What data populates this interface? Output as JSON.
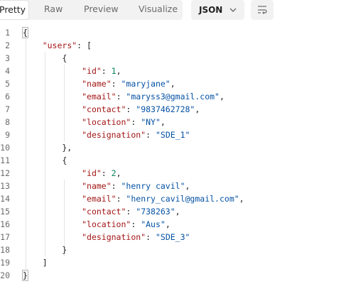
{
  "toolbar": {
    "tabs": [
      {
        "label": "Pretty"
      },
      {
        "label": "Raw"
      },
      {
        "label": "Preview"
      },
      {
        "label": "Visualize"
      }
    ],
    "format_select": {
      "value": "JSON"
    },
    "icons": {
      "chevron": "chevron-down-icon",
      "wrap": "wrap-lines-icon"
    }
  },
  "code": {
    "lines": [
      {
        "n": "1",
        "tokens": [
          {
            "t": "{",
            "c": "p"
          }
        ]
      },
      {
        "n": "2",
        "tokens": [
          {
            "t": "    ",
            "c": "p"
          },
          {
            "t": "\"users\"",
            "c": "k"
          },
          {
            "t": ": [",
            "c": "p"
          }
        ]
      },
      {
        "n": "3",
        "tokens": [
          {
            "t": "        {",
            "c": "p"
          }
        ]
      },
      {
        "n": "4",
        "tokens": [
          {
            "t": "            ",
            "c": "p"
          },
          {
            "t": "\"id\"",
            "c": "k"
          },
          {
            "t": ": ",
            "c": "p"
          },
          {
            "t": "1",
            "c": "n"
          },
          {
            "t": ",",
            "c": "p"
          }
        ]
      },
      {
        "n": "5",
        "tokens": [
          {
            "t": "            ",
            "c": "p"
          },
          {
            "t": "\"name\"",
            "c": "k"
          },
          {
            "t": ": ",
            "c": "p"
          },
          {
            "t": "\"maryjane\"",
            "c": "s"
          },
          {
            "t": ",",
            "c": "p"
          }
        ]
      },
      {
        "n": "6",
        "tokens": [
          {
            "t": "            ",
            "c": "p"
          },
          {
            "t": "\"email\"",
            "c": "k"
          },
          {
            "t": ": ",
            "c": "p"
          },
          {
            "t": "\"maryss3@gmail.com\"",
            "c": "s"
          },
          {
            "t": ",",
            "c": "p"
          }
        ]
      },
      {
        "n": "7",
        "tokens": [
          {
            "t": "            ",
            "c": "p"
          },
          {
            "t": "\"contact\"",
            "c": "k"
          },
          {
            "t": ": ",
            "c": "p"
          },
          {
            "t": "\"9837462728\"",
            "c": "s"
          },
          {
            "t": ",",
            "c": "p"
          }
        ]
      },
      {
        "n": "8",
        "tokens": [
          {
            "t": "            ",
            "c": "p"
          },
          {
            "t": "\"location\"",
            "c": "k"
          },
          {
            "t": ": ",
            "c": "p"
          },
          {
            "t": "\"NY\"",
            "c": "s"
          },
          {
            "t": ",",
            "c": "p"
          }
        ]
      },
      {
        "n": "9",
        "tokens": [
          {
            "t": "            ",
            "c": "p"
          },
          {
            "t": "\"designation\"",
            "c": "k"
          },
          {
            "t": ": ",
            "c": "p"
          },
          {
            "t": "\"SDE_1\"",
            "c": "s"
          }
        ]
      },
      {
        "n": "10",
        "tokens": [
          {
            "t": "        },",
            "c": "p"
          }
        ]
      },
      {
        "n": "11",
        "tokens": [
          {
            "t": "        {",
            "c": "p"
          }
        ]
      },
      {
        "n": "12",
        "tokens": [
          {
            "t": "            ",
            "c": "p"
          },
          {
            "t": "\"id\"",
            "c": "k"
          },
          {
            "t": ": ",
            "c": "p"
          },
          {
            "t": "2",
            "c": "n"
          },
          {
            "t": ",",
            "c": "p"
          }
        ]
      },
      {
        "n": "13",
        "tokens": [
          {
            "t": "            ",
            "c": "p"
          },
          {
            "t": "\"name\"",
            "c": "k"
          },
          {
            "t": ": ",
            "c": "p"
          },
          {
            "t": "\"henry cavil\"",
            "c": "s"
          },
          {
            "t": ",",
            "c": "p"
          }
        ]
      },
      {
        "n": "14",
        "tokens": [
          {
            "t": "            ",
            "c": "p"
          },
          {
            "t": "\"email\"",
            "c": "k"
          },
          {
            "t": ": ",
            "c": "p"
          },
          {
            "t": "\"henry_cavil@gmail.com\"",
            "c": "s"
          },
          {
            "t": ",",
            "c": "p"
          }
        ]
      },
      {
        "n": "15",
        "tokens": [
          {
            "t": "            ",
            "c": "p"
          },
          {
            "t": "\"contact\"",
            "c": "k"
          },
          {
            "t": ": ",
            "c": "p"
          },
          {
            "t": "\"738263\"",
            "c": "s"
          },
          {
            "t": ",",
            "c": "p"
          }
        ]
      },
      {
        "n": "16",
        "tokens": [
          {
            "t": "            ",
            "c": "p"
          },
          {
            "t": "\"location\"",
            "c": "k"
          },
          {
            "t": ": ",
            "c": "p"
          },
          {
            "t": "\"Aus\"",
            "c": "s"
          },
          {
            "t": ",",
            "c": "p"
          }
        ]
      },
      {
        "n": "17",
        "tokens": [
          {
            "t": "            ",
            "c": "p"
          },
          {
            "t": "\"designation\"",
            "c": "k"
          },
          {
            "t": ": ",
            "c": "p"
          },
          {
            "t": "\"SDE_3\"",
            "c": "s"
          }
        ]
      },
      {
        "n": "18",
        "tokens": [
          {
            "t": "        }",
            "c": "p"
          }
        ]
      },
      {
        "n": "19",
        "tokens": [
          {
            "t": "    ]",
            "c": "p"
          }
        ]
      },
      {
        "n": "20",
        "tokens": [
          {
            "t": "}",
            "c": "p"
          }
        ]
      }
    ]
  }
}
